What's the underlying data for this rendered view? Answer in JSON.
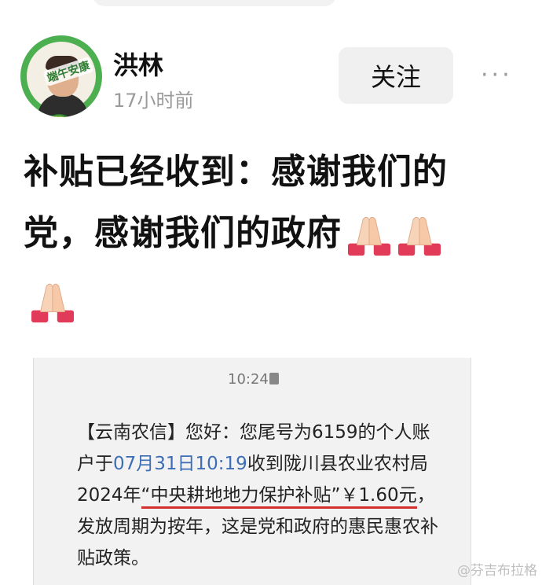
{
  "header": {
    "avatar_badge": "端午安康",
    "username": "洪林",
    "timestamp": "17小时前",
    "follow_label": "关注",
    "more_label": "···"
  },
  "post": {
    "text_line1": "补贴已经收到：感谢我们的",
    "text_line2": "党，感谢我们的政府"
  },
  "sms": {
    "time": "10:24",
    "sender": "【云南农信】",
    "part1": "您好：您尾号为6159的个人账户于",
    "date": "07月31日10:19",
    "part2": "收到陇川县农业农村局2024年",
    "subsidy_name": "“中央耕地地力保护补贴”",
    "amount": "￥1.60元",
    "part3": "，发放周期为按年，这是党和政府的惠民惠农补贴政策。"
  },
  "watermark": "@芬吉布拉格",
  "colors": {
    "accent_green": "#4caf50",
    "date_blue": "#3d6db5",
    "underline_red": "#d32f2f"
  }
}
